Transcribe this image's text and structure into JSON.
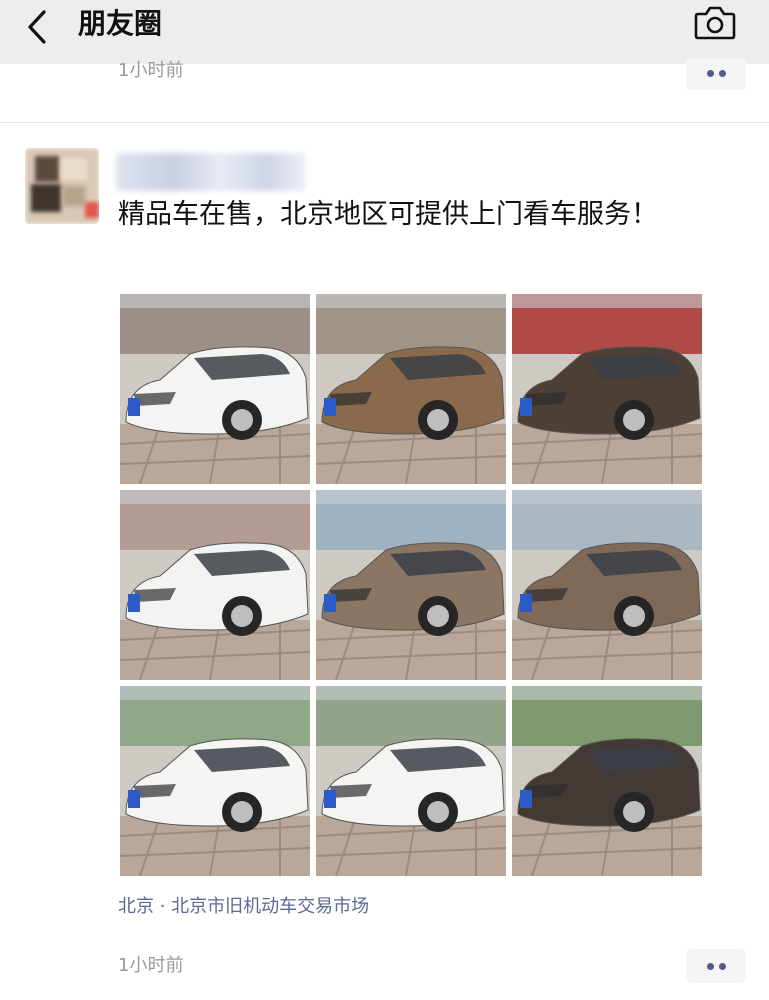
{
  "navbar": {
    "title": "朋友圈"
  },
  "previous_post": {
    "time": "1小时前"
  },
  "post": {
    "text": "精品车在售，北京地区可提供上门看车服务！",
    "location": "北京 · 北京市旧机动车交易市场",
    "time": "1小时前",
    "photos": [
      {
        "subject": "white-suv",
        "car_color": "#f4f4f2",
        "bg": "#9d8f86"
      },
      {
        "subject": "bronze-suv",
        "car_color": "#8a6a4d",
        "bg": "#a29588"
      },
      {
        "subject": "dark-brown-suv",
        "car_color": "#4e3f35",
        "bg": "#b04a45"
      },
      {
        "subject": "white-hatchback",
        "car_color": "#f3f3f2",
        "bg": "#b49c95"
      },
      {
        "subject": "bronze-sedan",
        "car_color": "#8b7664",
        "bg": "#9eb2c2"
      },
      {
        "subject": "bronze-sedan",
        "car_color": "#7f6a59",
        "bg": "#a9b7c2"
      },
      {
        "subject": "white-sedan",
        "car_color": "#f5f5f4",
        "bg": "#8fa889"
      },
      {
        "subject": "white-crossover",
        "car_color": "#f4f4f3",
        "bg": "#93a48b"
      },
      {
        "subject": "dark-sedan",
        "car_color": "#433a35",
        "bg": "#7e9a6e"
      }
    ]
  },
  "colors": {
    "link": "#5b6a91",
    "navbar_bg": "#ededed",
    "more_dots": "#4c5e86"
  },
  "icons": {
    "back": "chevron-left-icon",
    "camera": "camera-icon",
    "more": "more-dots-icon"
  }
}
